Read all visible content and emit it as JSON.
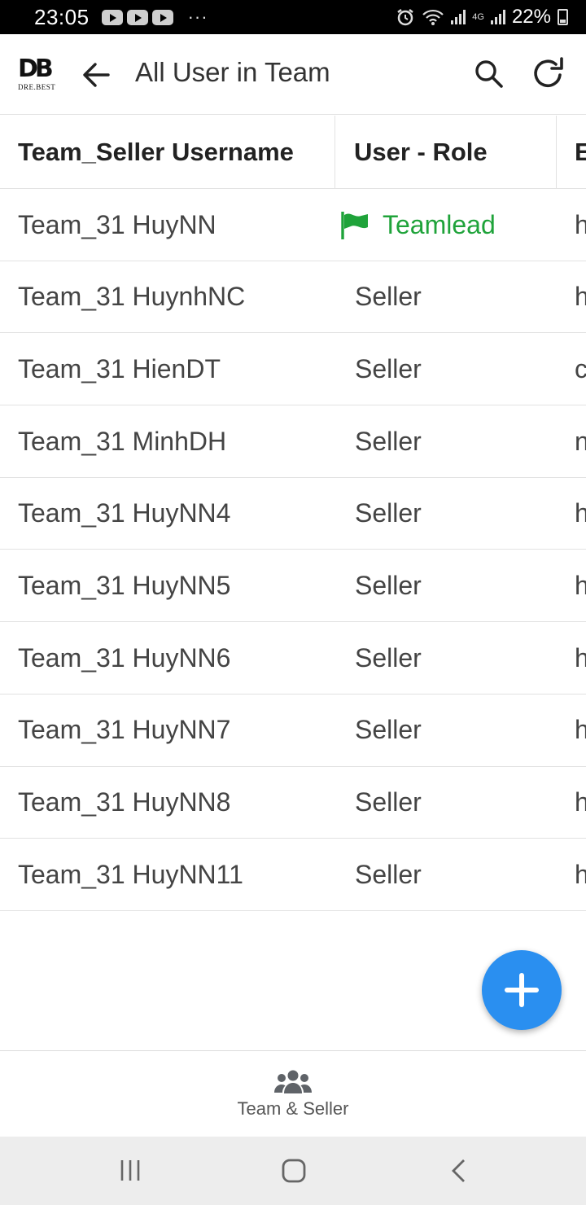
{
  "status_bar": {
    "time": "23:05",
    "overflow": "···",
    "network": "4G",
    "battery": "22%",
    "icons": [
      "youtube-icon",
      "youtube-icon",
      "youtube-icon",
      "alarm-icon",
      "wifi-icon",
      "signal-icon",
      "signal-icon",
      "battery-icon"
    ]
  },
  "app_bar": {
    "logo_mark": "DB",
    "logo_sub": "DRE.BEST",
    "title": "All User in Team",
    "actions": [
      "back-arrow-icon",
      "search-icon",
      "refresh-icon"
    ]
  },
  "table": {
    "headers": [
      "Team_Seller Username",
      "User - Role",
      "E"
    ],
    "rows": [
      {
        "username": "Team_31 HuyNN",
        "role": "Teamlead",
        "email": "h"
      },
      {
        "username": "Team_31 HuynhNC",
        "role": "Seller",
        "email": "h"
      },
      {
        "username": "Team_31 HienDT",
        "role": "Seller",
        "email": "c"
      },
      {
        "username": "Team_31 MinhDH",
        "role": "Seller",
        "email": "n"
      },
      {
        "username": "Team_31 HuyNN4",
        "role": "Seller",
        "email": "h"
      },
      {
        "username": "Team_31 HuyNN5",
        "role": "Seller",
        "email": "h"
      },
      {
        "username": "Team_31 HuyNN6",
        "role": "Seller",
        "email": "h"
      },
      {
        "username": "Team_31 HuyNN7",
        "role": "Seller",
        "email": "h"
      },
      {
        "username": "Team_31 HuyNN8",
        "role": "Seller",
        "email": "h"
      },
      {
        "username": "Team_31 HuyNN11",
        "role": "Seller",
        "email": "h"
      }
    ]
  },
  "fab": {
    "icon": "plus-icon",
    "color": "#2a8ff0"
  },
  "bottom_nav": {
    "label": "Team & Seller",
    "icon": "users-icon"
  },
  "colors": {
    "teamlead": "#1fa33a",
    "accent": "#2a8ff0"
  }
}
